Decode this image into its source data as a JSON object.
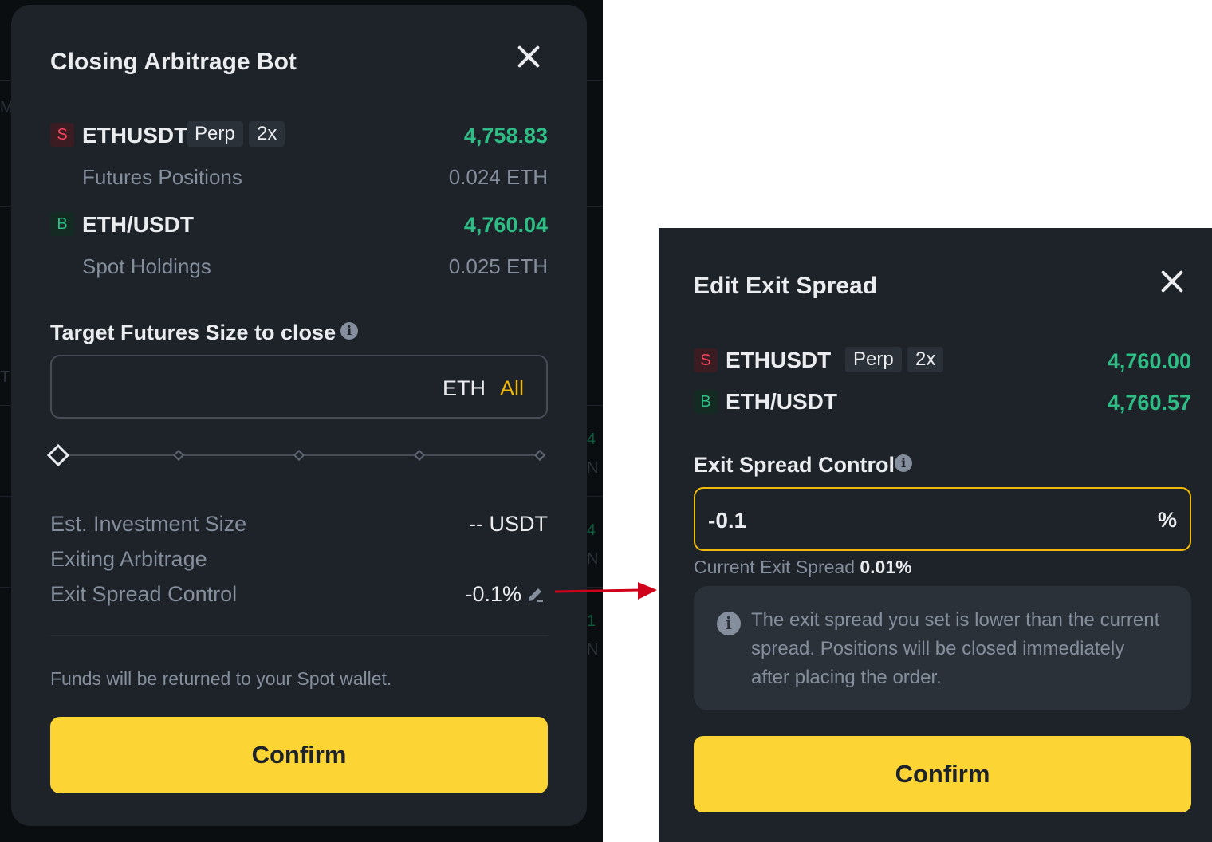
{
  "closing_modal": {
    "title": "Closing Arbitrage Bot",
    "futures": {
      "side": "S",
      "symbol": "ETHUSDT",
      "type_tag": "Perp",
      "leverage_tag": "2x",
      "price": "4,758.83",
      "position_label": "Futures Positions",
      "position_value": "0.024 ETH"
    },
    "spot": {
      "side": "B",
      "symbol": "ETH/USDT",
      "price": "4,760.04",
      "holdings_label": "Spot Holdings",
      "holdings_value": "0.025 ETH"
    },
    "target_label": "Target Futures Size to close",
    "input": {
      "value": "",
      "unit": "ETH",
      "all_label": "All"
    },
    "slider": {
      "value_fraction": 0,
      "steps": 5
    },
    "summary": [
      {
        "label": "Est. Investment Size",
        "value": "-- USDT"
      },
      {
        "label": "Exiting Arbitrage",
        "value": ""
      },
      {
        "label": "Exit Spread Control",
        "value": "-0.1%"
      }
    ],
    "note": "Funds will be returned to your Spot wallet.",
    "confirm_label": "Confirm"
  },
  "edit_modal": {
    "title": "Edit Exit Spread",
    "futures": {
      "side": "S",
      "symbol": "ETHUSDT",
      "type_tag": "Perp",
      "leverage_tag": "2x",
      "price": "4,760.00"
    },
    "spot": {
      "side": "B",
      "symbol": "ETH/USDT",
      "price": "4,760.57"
    },
    "control_label": "Exit Spread Control",
    "input": {
      "value": "-0.1",
      "unit": "%"
    },
    "current_label": "Current Exit Spread",
    "current_value": "0.01%",
    "warning_lines": [
      "The exit spread you set is lower than the current",
      "spread. Positions will be closed immediately",
      "after placing the order."
    ],
    "confirm_label": "Confirm"
  },
  "colors": {
    "accent": "#fcd535",
    "buy_green": "#2ebd85",
    "sell_red": "#f6465d",
    "arrow_red": "#d0021b"
  }
}
